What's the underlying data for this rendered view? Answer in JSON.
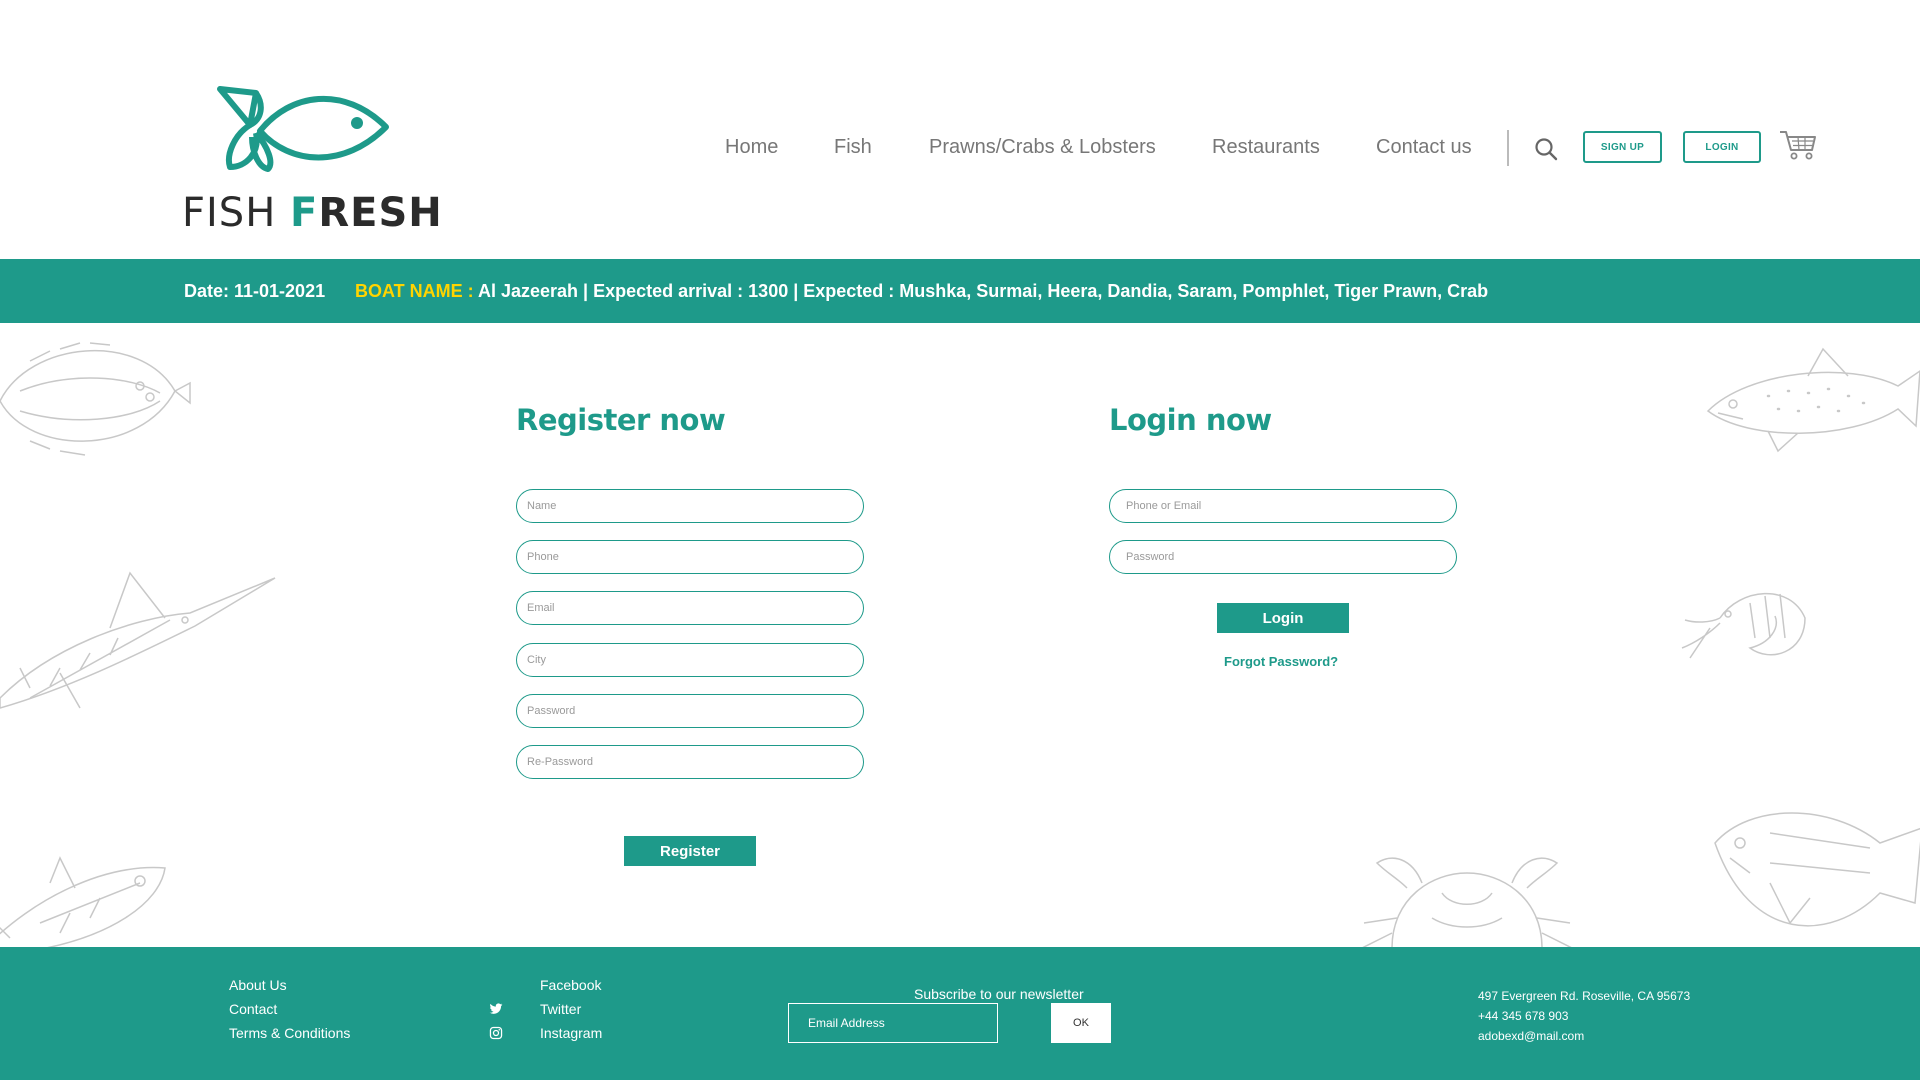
{
  "logo": {
    "word1": "FISH",
    "word2_first": "F",
    "word2_rest": "RESH"
  },
  "nav": {
    "items": [
      "Home",
      "Fish",
      "Prawns/Crabs & Lobsters",
      "Restaurants",
      "Contact us"
    ],
    "signup_label": "SIGN UP",
    "login_label": "LOGIN"
  },
  "icons": {
    "search": "search-icon",
    "cart": "cart-icon",
    "twitter": "twitter-icon",
    "instagram": "instagram-icon"
  },
  "ticker": {
    "date": "Date: 11-01-2021",
    "boat_label": "BOAT NAME :",
    "details": "Al Jazeerah | Expected arrival : 1300 | Expected : Mushka, Surmai, Heera, Dandia, Saram, Pomphlet, Tiger Prawn, Crab"
  },
  "register": {
    "title": "Register now",
    "placeholders": [
      "Name",
      "Phone",
      "Email",
      "City",
      "Password",
      "Re-Password"
    ],
    "button": "Register"
  },
  "login": {
    "title": "Login now",
    "placeholders": [
      "Phone or Email",
      "Password"
    ],
    "button": "Login",
    "forgot": "Forgot Password?"
  },
  "footer": {
    "links": [
      "About Us",
      "Contact",
      "Terms & Conditions"
    ],
    "social": [
      "Facebook",
      "Twitter",
      "Instagram"
    ],
    "newsletter_label": "Subscribe to our newsletter",
    "email_placeholder": "Email Address",
    "ok_label": "OK",
    "address": "497 Evergreen Rd. Roseville, CA 95673",
    "phone": "+44 345 678 903",
    "email": "adobexd@mail.com"
  },
  "colors": {
    "brand": "#1e9a8a",
    "highlight": "#ffd400"
  }
}
